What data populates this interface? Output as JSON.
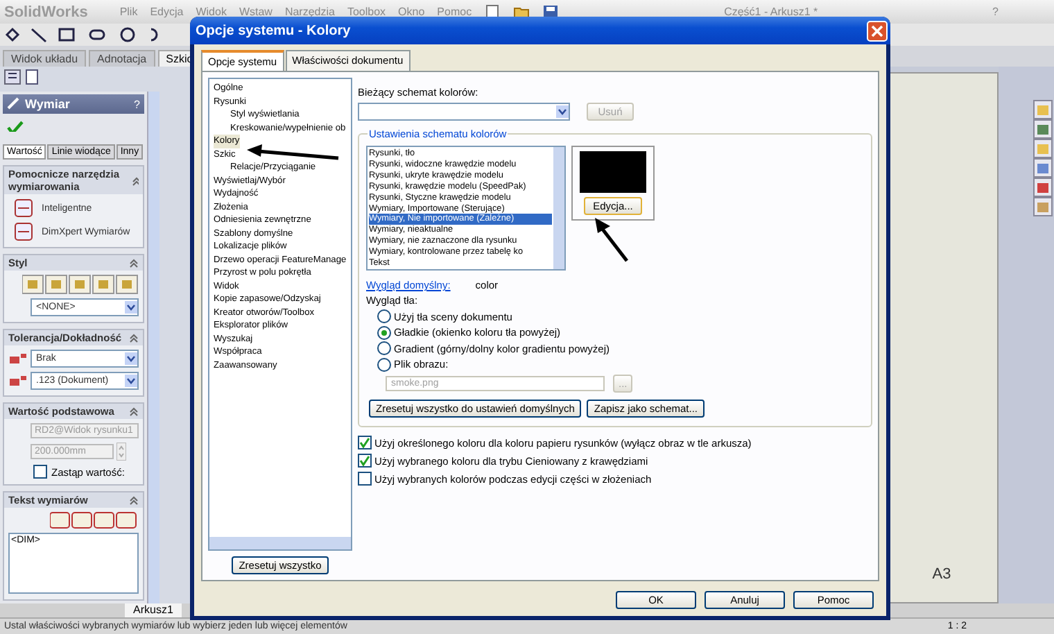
{
  "app": {
    "logo": "SolidWorks",
    "menu": [
      "Plik",
      "Edycja",
      "Widok",
      "Wstaw",
      "Narzędzia",
      "Toolbox",
      "Okno",
      "Pomoc"
    ],
    "title": "Część1 - Arkusz1 *",
    "help": "?"
  },
  "command_tabs": [
    {
      "label": "Widok układu",
      "selected": false
    },
    {
      "label": "Adnotacja",
      "selected": false
    },
    {
      "label": "Szkic",
      "selected": true
    }
  ],
  "property_manager": {
    "title": "Wymiar",
    "help": "?",
    "tabs": [
      {
        "label": "Wartość",
        "selected": true
      },
      {
        "label": "Linie wiodące",
        "selected": false
      },
      {
        "label": "Inny",
        "selected": false
      }
    ],
    "sections": [
      {
        "kind": "tools",
        "title": "Pomocnicze narzędzia wymiarowania",
        "items": [
          "Inteligentne",
          "DimXpert Wymiarów"
        ]
      },
      {
        "kind": "style",
        "title": "Styl",
        "dropdown": "<NONE>"
      },
      {
        "kind": "tolerance",
        "title": "Tolerancja/Dokładność",
        "dropdowns": [
          "Brak",
          ".123 (Dokument)"
        ]
      },
      {
        "kind": "value",
        "title": "Wartość podstawowa",
        "reference": "RD2@Widok rysunku1",
        "value": "200.000mm",
        "override": {
          "label": "Zastąp wartość:",
          "checked": false
        }
      },
      {
        "kind": "text",
        "title": "Tekst wymiarów",
        "text": "<DIM>"
      }
    ]
  },
  "sheet_tabs": [
    {
      "label": "Arkusz1",
      "selected": true
    }
  ],
  "sheet": {
    "size": "A3"
  },
  "status_bar": {
    "message": "Ustal właściwości wybranych wymiarów lub wybierz jeden lub więcej elementów",
    "scale": "1 : 2"
  },
  "dialog": {
    "title": "Opcje systemu - Kolory",
    "tabs": [
      {
        "label": "Opcje systemu",
        "selected": true
      },
      {
        "label": "Właściwości dokumentu",
        "selected": false
      }
    ],
    "tree": [
      {
        "label": "Ogólne",
        "selected": false
      },
      {
        "label": "Rysunki",
        "selected": false,
        "children": [
          {
            "label": "Styl wyświetlania",
            "selected": false
          },
          {
            "label": "Kreskowanie/wypełnienie ob",
            "selected": false
          }
        ]
      },
      {
        "label": "Kolory",
        "selected": true
      },
      {
        "label": "Szkic",
        "selected": false,
        "children": [
          {
            "label": "Relacje/Przyciąganie",
            "selected": false
          }
        ]
      },
      {
        "label": "Wyświetlaj/Wybór",
        "selected": false
      },
      {
        "label": "Wydajność",
        "selected": false
      },
      {
        "label": "Złożenia",
        "selected": false
      },
      {
        "label": "Odniesienia zewnętrzne",
        "selected": false
      },
      {
        "label": "Szablony domyślne",
        "selected": false
      },
      {
        "label": "Lokalizacje plików",
        "selected": false
      },
      {
        "label": "Drzewo operacji FeatureManage",
        "selected": false
      },
      {
        "label": "Przyrost w polu pokrętła",
        "selected": false
      },
      {
        "label": "Widok",
        "selected": false
      },
      {
        "label": "Kopie zapasowe/Odzyskaj",
        "selected": false
      },
      {
        "label": "Kreator otworów/Toolbox",
        "selected": false
      },
      {
        "label": "Eksplorator plików",
        "selected": false
      },
      {
        "label": "Wyszukaj",
        "selected": false
      },
      {
        "label": "Współpraca",
        "selected": false
      },
      {
        "label": "Zaawansowany",
        "selected": false
      }
    ],
    "reset_all": "Zresetuj wszystko",
    "scheme_label": "Bieżący schemat kolorów:",
    "delete_button": {
      "label": "Usuń",
      "disabled": true
    },
    "group_title": "Ustawienia schematu kolorów",
    "color_items": [
      {
        "label": "Rysunki, tło",
        "selected": false
      },
      {
        "label": "Rysunki, widoczne krawędzie modelu",
        "selected": false
      },
      {
        "label": "Rysunki, ukryte krawędzie modelu",
        "selected": false
      },
      {
        "label": "Rysunki, krawędzie modelu (SpeedPak)",
        "selected": false
      },
      {
        "label": "Rysunki, Styczne krawędzie modelu",
        "selected": false
      },
      {
        "label": "Wymiary, Importowane (Sterujące)",
        "selected": false
      },
      {
        "label": "Wymiary, Nie importowane (Zależne)",
        "selected": true
      },
      {
        "label": "Wymiary, nieaktualne",
        "selected": false
      },
      {
        "label": "Wymiary, nie zaznaczone dla rysunku",
        "selected": false
      },
      {
        "label": "Wymiary, kontrolowane przez tabelę ko",
        "selected": false
      },
      {
        "label": "Tekst",
        "selected": false
      }
    ],
    "edit_button": "Edycja...",
    "default_look": {
      "label": "Wygląd domyślny:",
      "value": "color"
    },
    "background": {
      "label": "Wygląd tła:",
      "options": [
        {
          "label": "Użyj tła sceny dokumentu",
          "selected": false
        },
        {
          "label": "Gładkie (okienko koloru tła powyżej)",
          "selected": true
        },
        {
          "label": "Gradient (górny/dolny kolor gradientu powyżej)",
          "selected": false
        },
        {
          "label": "Plik obrazu:",
          "selected": false
        }
      ],
      "file": {
        "value": "smoke.png",
        "disabled": true
      },
      "browse": "..."
    },
    "scheme_buttons": [
      "Zresetuj wszystko do ustawień domyślnych",
      "Zapisz jako schemat..."
    ],
    "checkboxes": [
      {
        "label": "Użyj określonego koloru dla koloru papieru rysunków (wyłącz obraz w tle arkusza)",
        "checked": true
      },
      {
        "label": "Użyj wybranego koloru dla trybu Cieniowany z krawędziami",
        "checked": true
      },
      {
        "label": "Użyj wybranych kolorów podczas edycji części w złożeniach",
        "checked": false
      }
    ],
    "buttons": [
      "OK",
      "Anuluj",
      "Pomoc"
    ]
  }
}
